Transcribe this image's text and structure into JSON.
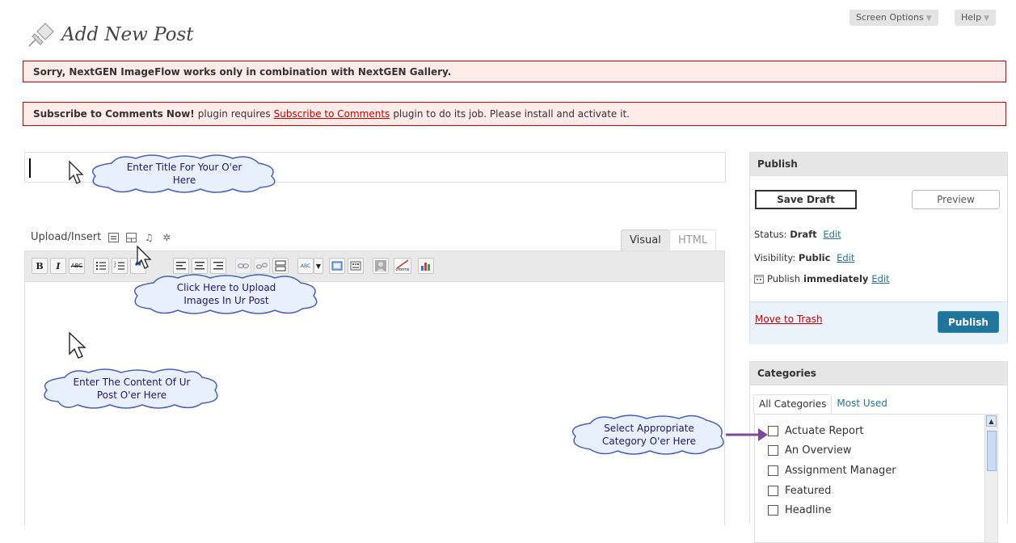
{
  "header": {
    "screen_options": "Screen Options",
    "help": "Help",
    "page_title": "Add New Post"
  },
  "notices": {
    "imageflow": "Sorry, NextGEN ImageFlow works only in combination with NextGEN Gallery.",
    "subscribe_bold": "Subscribe to Comments Now!",
    "subscribe_pre": "plugin requires",
    "subscribe_link": "Subscribe to Comments",
    "subscribe_post": "plugin to do its job. Please install and activate it."
  },
  "editor": {
    "upload_insert": "Upload/Insert",
    "tab_visual": "Visual",
    "tab_html": "HTML",
    "toolbar": {
      "bold": "B",
      "italic": "I",
      "strike": "ABC",
      "quote": "“",
      "spell": "ABC",
      "cforms": "cforms"
    }
  },
  "callouts": {
    "title": "Enter Title For Your O'er Here",
    "upload": "Click Here to Upload Images In Ur Post",
    "content": "Enter The Content Of Ur Post O'er Here",
    "category": "Select Appropriate Category O'er Here"
  },
  "publish_box": {
    "heading": "Publish",
    "save_draft": "Save Draft",
    "preview": "Preview",
    "status_label": "Status:",
    "status_value": "Draft",
    "visibility_label": "Visibility:",
    "visibility_value": "Public",
    "publish_label": "Publish",
    "publish_value": "immediately",
    "edit": "Edit",
    "trash": "Move to Trash",
    "publish_button": "Publish"
  },
  "categories_box": {
    "heading": "Categories",
    "tab_all": "All Categories",
    "tab_most_used": "Most Used",
    "items": [
      "Actuate Report",
      "An Overview",
      "Assignment Manager",
      "Featured",
      "Headline"
    ]
  }
}
